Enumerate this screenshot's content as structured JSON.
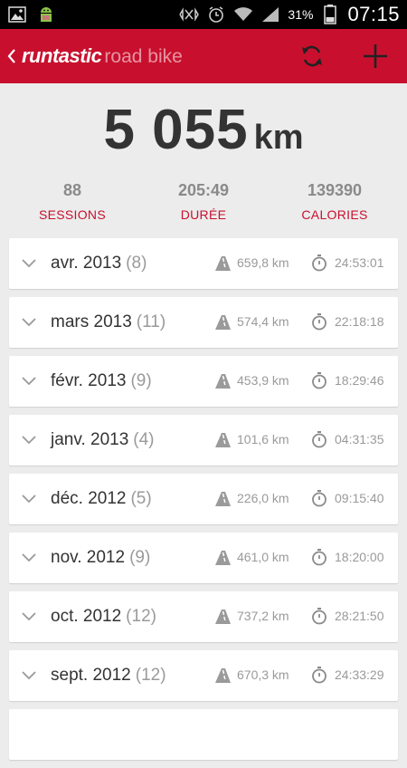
{
  "status_bar": {
    "battery_pct": "31%",
    "time": "07:15",
    "icons": [
      "gallery-icon",
      "android-debug-icon",
      "vibrate-icon",
      "alarm-icon",
      "wifi-icon",
      "signal-icon",
      "battery-icon"
    ]
  },
  "app_bar": {
    "brand": "runtastic",
    "sub": "road bike",
    "actions": [
      "sync-icon",
      "add-icon"
    ]
  },
  "summary": {
    "total_value": "5 055",
    "total_unit": "km",
    "stats": [
      {
        "value": "88",
        "label": "SESSIONS"
      },
      {
        "value": "205:49",
        "label": "DURÉE"
      },
      {
        "value": "139390",
        "label": "CALORIES"
      }
    ]
  },
  "months": [
    {
      "name": "avr. 2013",
      "count": "(8)",
      "distance": "659,8 km",
      "duration": "24:53:01"
    },
    {
      "name": "mars 2013",
      "count": "(11)",
      "distance": "574,4 km",
      "duration": "22:18:18"
    },
    {
      "name": "févr. 2013",
      "count": "(9)",
      "distance": "453,9 km",
      "duration": "18:29:46"
    },
    {
      "name": "janv. 2013",
      "count": "(4)",
      "distance": "101,6 km",
      "duration": "04:31:35"
    },
    {
      "name": "déc. 2012",
      "count": "(5)",
      "distance": "226,0 km",
      "duration": "09:15:40"
    },
    {
      "name": "nov. 2012",
      "count": "(9)",
      "distance": "461,0 km",
      "duration": "18:20:00"
    },
    {
      "name": "oct. 2012",
      "count": "(12)",
      "distance": "737,2 km",
      "duration": "28:21:50"
    },
    {
      "name": "sept. 2012",
      "count": "(12)",
      "distance": "670,3 km",
      "duration": "24:33:29"
    }
  ],
  "colors": {
    "accent": "#c8102e",
    "text_dark": "#333333",
    "text_muted": "#9a9a9a",
    "background": "#ececec"
  }
}
